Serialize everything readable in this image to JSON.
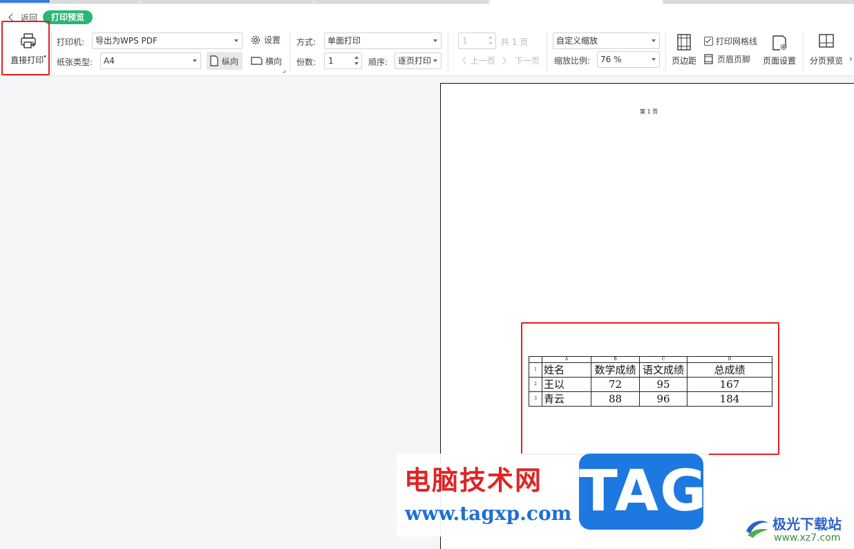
{
  "header": {
    "back_label": "返回",
    "mode_tag": "打印预览"
  },
  "toolbar": {
    "direct_print_label": "直接打印",
    "printer_label": "打印机:",
    "printer_value": "导出为WPS PDF",
    "settings_label": "设置",
    "paper_label": "纸张类型:",
    "paper_value": "A4",
    "portrait_label": "纵向",
    "landscape_label": "横向",
    "method_label": "方式:",
    "method_value": "单面打印",
    "copies_label": "份数:",
    "copies_value": "1",
    "order_label": "顺序:",
    "order_value": "逐页打印",
    "page_value": "1",
    "total_pages": "共 1 页",
    "prev_label": "上一页",
    "next_label": "下一页",
    "zoom_mode_value": "自定义缩放",
    "zoom_ratio_label": "缩放比例:",
    "zoom_ratio_value": "76 %",
    "margins_label": "页边距",
    "gridlines_label": "打印网格线",
    "gridlines_checked": true,
    "header_footer_label": "页眉页脚",
    "page_setup_label": "页面设置",
    "page_break_label": "分页预览"
  },
  "preview": {
    "page_header": "第 1 页",
    "columns": [
      "A",
      "B",
      "C",
      "D"
    ],
    "rows": [
      {
        "num": "1",
        "cells": [
          "姓名",
          "数学成绩",
          "语文成绩",
          "总成绩"
        ]
      },
      {
        "num": "2",
        "cells": [
          "王以",
          "72",
          "95",
          "167"
        ]
      },
      {
        "num": "3",
        "cells": [
          "青云",
          "88",
          "96",
          "184"
        ]
      }
    ]
  },
  "watermark": {
    "site_name": "电脑技术网",
    "site_url": "www.tagxp.com",
    "tag_logo": "TAG",
    "brand": "极光下载站",
    "brand_url": "www.xz7.com"
  },
  "colors": {
    "accent_green": "#2bb673",
    "highlight_red": "#e02020",
    "tag_blue": "#1d78e0"
  }
}
